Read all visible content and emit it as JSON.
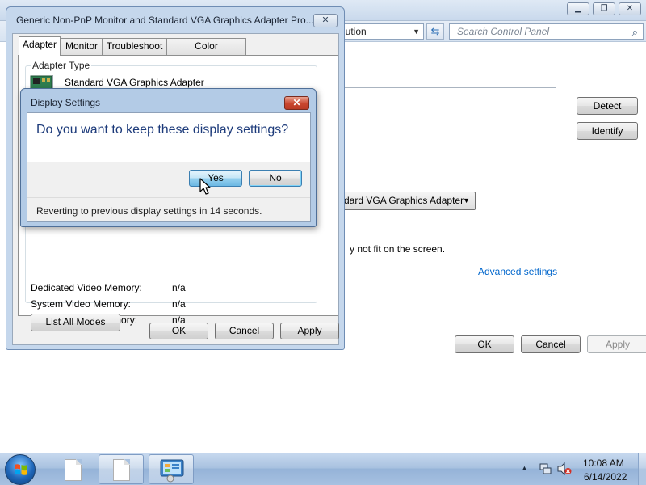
{
  "background_window": {
    "address_fragment": "lution",
    "search_placeholder": "Search Control Panel",
    "detect_label": "Detect",
    "identify_label": "Identify",
    "display_select_value": "dard VGA Graphics Adapter",
    "notice_fragment": "y not fit on the screen.",
    "advanced_link": "Advanced settings",
    "ok_label": "OK",
    "cancel_label": "Cancel",
    "apply_label": "Apply"
  },
  "properties_dialog": {
    "title": "Generic Non-PnP Monitor and Standard VGA Graphics Adapter Pro...",
    "close_glyph": "✕",
    "tabs": [
      {
        "label": "Adapter"
      },
      {
        "label": "Monitor"
      },
      {
        "label": "Troubleshoot"
      },
      {
        "label": "Color Management"
      }
    ],
    "adapter_type_legend": "Adapter Type",
    "adapter_name": "Standard VGA Graphics Adapter",
    "memory": [
      {
        "label": "Dedicated Video Memory:",
        "value": "n/a"
      },
      {
        "label": "System Video Memory:",
        "value": "n/a"
      },
      {
        "label": "Shared System Memory:",
        "value": "n/a"
      }
    ],
    "list_all_modes": "List All Modes",
    "ok_label": "OK",
    "cancel_label": "Cancel",
    "apply_label": "Apply"
  },
  "display_settings_modal": {
    "title": "Display Settings",
    "close_glyph": "✕",
    "question": "Do you want to keep these display settings?",
    "yes_label": "Yes",
    "no_label": "No",
    "revert_message": "Reverting to previous display settings in 14 seconds."
  },
  "taskbar": {
    "time": "10:08 AM",
    "date": "6/14/2022",
    "tray_expand_glyph": "▲"
  }
}
